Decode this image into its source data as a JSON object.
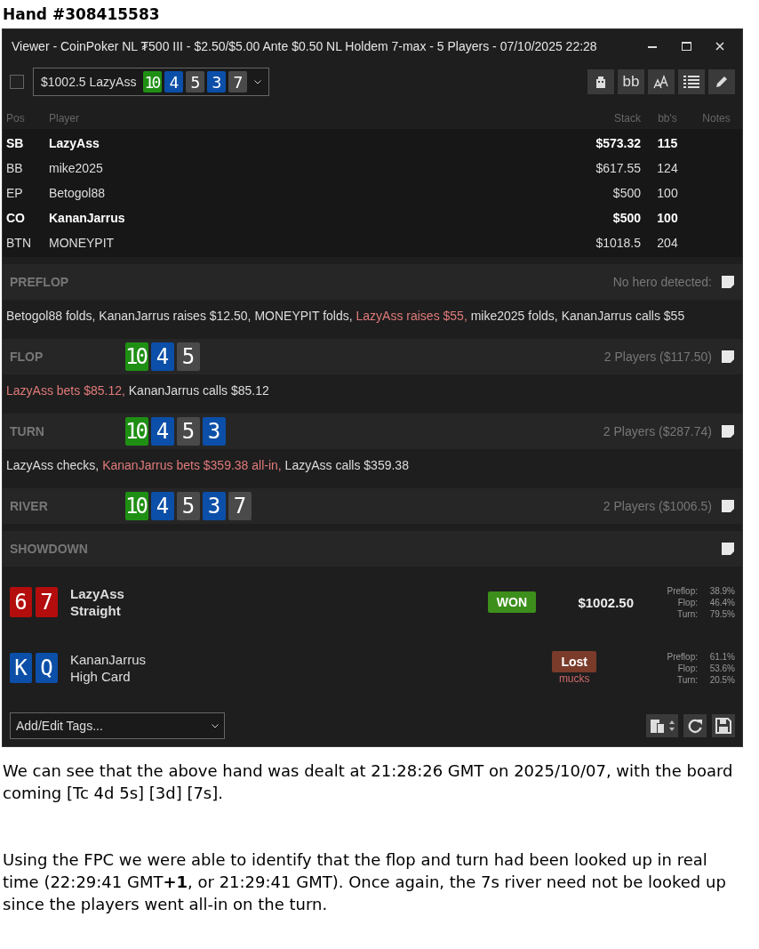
{
  "heading": "Hand #308415583",
  "window": {
    "title": "Viewer - CoinPoker NL ₮500 III - $2.50/$5.00 Ante $0.50 NL Holdem 7-max  - 5 Players - 07/10/2025 22:28"
  },
  "toolbar": {
    "select_checked": false,
    "hand_select": {
      "label": "$1002.5 LazyAss",
      "cards": [
        {
          "rank": "10",
          "color": "#1f8f14"
        },
        {
          "rank": "4",
          "color": "#0b4fa8"
        },
        {
          "rank": "5",
          "color": "#4a4a4a"
        },
        {
          "rank": "3",
          "color": "#0b4fa8"
        },
        {
          "rank": "7",
          "color": "#4a4a4a"
        }
      ]
    },
    "buttons": [
      "bb"
    ]
  },
  "players": {
    "columns": [
      "Pos",
      "Player",
      "Stack",
      "bb's",
      "Notes"
    ],
    "rows": [
      {
        "pos": "SB",
        "name": "LazyAss",
        "stack": "$573.32",
        "bbs": "115",
        "in_hand": true
      },
      {
        "pos": "BB",
        "name": "mike2025",
        "stack": "$617.55",
        "bbs": "124",
        "in_hand": false
      },
      {
        "pos": "EP",
        "name": "Betogol88",
        "stack": "$500",
        "bbs": "100",
        "in_hand": false
      },
      {
        "pos": "CO",
        "name": "KananJarrus",
        "stack": "$500",
        "bbs": "100",
        "in_hand": true
      },
      {
        "pos": "BTN",
        "name": "MONEYPIT",
        "stack": "$1018.5",
        "bbs": "204",
        "in_hand": false
      }
    ]
  },
  "streets": [
    {
      "name": "PREFLOP",
      "info": "No hero detected:",
      "actions": [
        {
          "text": "Betogol88 folds, KananJarrus raises $12.50, MONEYPIT folds, ",
          "hero": false
        },
        {
          "text": "LazyAss raises $55,",
          "hero": true
        },
        {
          "text": " mike2025 folds, KananJarrus calls $55",
          "hero": false
        }
      ]
    },
    {
      "name": "FLOP",
      "info": "2 Players ($117.50)",
      "board": [
        {
          "rank": "10",
          "color": "#1f8f14"
        },
        {
          "rank": "4",
          "color": "#0b4fa8"
        },
        {
          "rank": "5",
          "color": "#4a4a4a"
        }
      ],
      "actions": [
        {
          "text": "LazyAss bets $85.12,",
          "hero": true
        },
        {
          "text": " KananJarrus calls $85.12",
          "hero": false
        }
      ]
    },
    {
      "name": "TURN",
      "info": "2 Players ($287.74)",
      "board": [
        {
          "rank": "10",
          "color": "#1f8f14"
        },
        {
          "rank": "4",
          "color": "#0b4fa8"
        },
        {
          "rank": "5",
          "color": "#4a4a4a"
        },
        {
          "rank": "3",
          "color": "#0b4fa8"
        }
      ],
      "actions": [
        {
          "text": "LazyAss checks, ",
          "hero": false
        },
        {
          "text": "KananJarrus bets $359.38 all-in,",
          "hero": true
        },
        {
          "text": " LazyAss calls $359.38",
          "hero": false
        }
      ]
    },
    {
      "name": "RIVER",
      "info": "2 Players ($1006.5)",
      "board": [
        {
          "rank": "10",
          "color": "#1f8f14"
        },
        {
          "rank": "4",
          "color": "#0b4fa8"
        },
        {
          "rank": "5",
          "color": "#4a4a4a"
        },
        {
          "rank": "3",
          "color": "#0b4fa8"
        },
        {
          "rank": "7",
          "color": "#4a4a4a"
        }
      ]
    },
    {
      "name": "SHOWDOWN"
    }
  ],
  "results": [
    {
      "cards": [
        {
          "rank": "6",
          "color": "#b30d0d"
        },
        {
          "rank": "7",
          "color": "#b30d0d"
        }
      ],
      "name": "LazyAss",
      "hand": "Straight",
      "kind": "won",
      "badge": "WON",
      "amount": "$1002.50",
      "equity": [
        {
          "label": "Preflop:",
          "value": "38.9%"
        },
        {
          "label": "Flop:",
          "value": "46.4%"
        },
        {
          "label": "Turn:",
          "value": "79.5%"
        }
      ]
    },
    {
      "cards": [
        {
          "rank": "K",
          "color": "#0b4fa8"
        },
        {
          "rank": "Q",
          "color": "#0b4fa8"
        }
      ],
      "name": "KananJarrus",
      "hand": "High Card",
      "kind": "lost",
      "badge": "Lost",
      "note": "mucks",
      "equity": [
        {
          "label": "Preflop:",
          "value": "61.1%"
        },
        {
          "label": "Flop:",
          "value": "53.6%"
        },
        {
          "label": "Turn:",
          "value": "20.5%"
        }
      ]
    }
  ],
  "tags": {
    "label": "Add/Edit Tags..."
  },
  "paragraphs": [
    "We can see that the above hand was dealt at 21:28:26 GMT on 2025/10/07, with the board coming [Tc 4d 5s] [3d] [7s].",
    "Using the FPC we were able to identify that the flop and turn had been looked up in real time (22:29:41 GMT**+1**, or 21:29:41 GMT). Once again, the 7s river need not be looked up since the players went all-in on the turn."
  ]
}
